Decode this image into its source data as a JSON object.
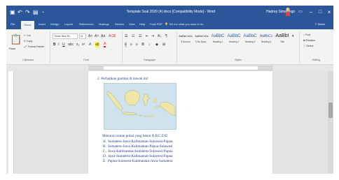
{
  "window": {
    "title": "Template Soal 2020 (4) docx [Compatibility Mode] - Word",
    "user": "Hadrey Simalango",
    "quick_access": [
      "save-icon",
      "undo-icon",
      "redo-icon",
      "customize-icon"
    ],
    "controls": [
      "ribbon-display-icon",
      "minimize-icon",
      "maximize-icon",
      "close-icon"
    ]
  },
  "tabs": {
    "items": [
      "File",
      "Home",
      "Insert",
      "Design",
      "Layout",
      "References",
      "Mailings",
      "Review",
      "View",
      "Help",
      "Foxit PDF"
    ],
    "active": "Home",
    "tell_me": "Tell me what you want to do",
    "share": "Share"
  },
  "ribbon": {
    "clipboard": {
      "paste": "Paste",
      "cut": "Cut",
      "copy": "Copy",
      "format_painter": "Format Painter",
      "label": "Clipboard"
    },
    "font": {
      "name": "Times New Ro",
      "size": "11",
      "label": "Font"
    },
    "paragraph": {
      "label": "Paragraph"
    },
    "styles": {
      "items": [
        {
          "preview": "AaBbCcDc",
          "name": "¶ Normal"
        },
        {
          "preview": "AaBbCcDc",
          "name": "¶ No Spac..."
        },
        {
          "preview": "AaBbC",
          "name": "Heading 1"
        },
        {
          "preview": "AaBbC",
          "name": "Heading 2"
        },
        {
          "preview": "AaBbC",
          "name": "Heading 3"
        },
        {
          "preview": "AaBbCc",
          "name": "Heading 4"
        },
        {
          "preview": "AaBbI",
          "name": "Title"
        }
      ],
      "label": "Styles"
    },
    "editing": {
      "find": "Find",
      "replace": "Replace",
      "select": "Select",
      "label": "Editing"
    }
  },
  "document": {
    "question": "2.   Perhatikan gambar di bawah ini!",
    "prompt": "Menurut urutan pulau yang benar A.B.C.D.E",
    "options": [
      {
        "letter": "A.",
        "text": "Sumatera-Jawa-Kalimantan-Sulawesi-Papua"
      },
      {
        "letter": "B.",
        "text": "Sumatera-Jawa-Kalimantan-Papua-Sulawesi"
      },
      {
        "letter": "C.",
        "text": "Jawa-Kalimantan-Sumatera-Sulawesi-Papua"
      },
      {
        "letter": "D.",
        "text": "Jawa-Sumatera-Kalimantan-Sulawesi-Papua"
      },
      {
        "letter": "E.",
        "text": "Papua-Sulawesi-Kalimantan-Jawa-Sumatera"
      }
    ],
    "map_colors": {
      "sea": "#cfe3ef",
      "land": "#f0e6a8",
      "border": "#9a9a7a"
    }
  },
  "theme": {
    "accent": "#2b579a",
    "doc_text": "#1f3a8a"
  }
}
